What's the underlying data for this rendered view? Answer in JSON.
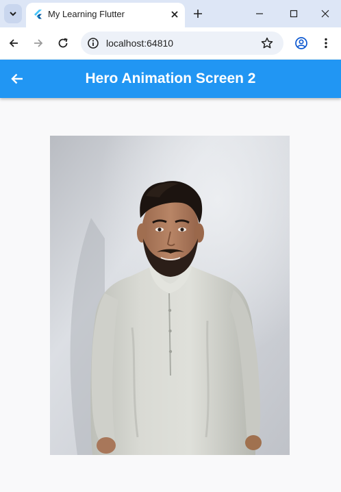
{
  "browser": {
    "tab_title": "My Learning Flutter",
    "url": "localhost:64810"
  },
  "app": {
    "title": "Hero Animation Screen 2",
    "primary_color": "#2196f3"
  },
  "icons": {
    "tab_search": "chevron-down-icon",
    "favicon": "flutter-logo-icon",
    "tab_close": "close-icon",
    "new_tab": "plus-icon",
    "back": "arrow-left-icon",
    "forward": "arrow-right-icon",
    "reload": "reload-icon",
    "site_info": "info-icon",
    "bookmark": "star-icon",
    "profile": "account-icon",
    "menu": "more-vert-icon"
  }
}
